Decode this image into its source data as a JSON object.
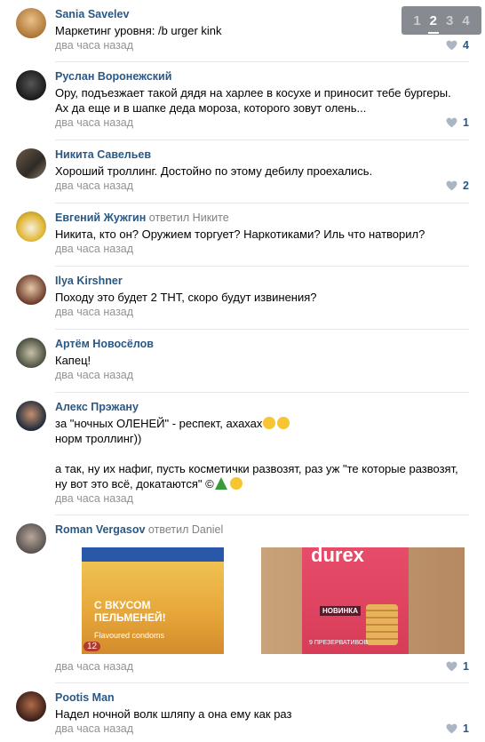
{
  "pager": {
    "pages": [
      "1",
      "2",
      "3",
      "4"
    ],
    "active": "2"
  },
  "comments": [
    {
      "author": "Sania Savelev",
      "replied_to": "",
      "text": "Маркетинг уровня: /b urger kink",
      "time": "два часа назад",
      "likes": "4"
    },
    {
      "author": "Руслан Воронежский",
      "replied_to": "",
      "text": "Ору, подъезжает такой дядя на харлее в косухе и приносит тебе бургеры.\nАх да еще и в шапке деда мороза, которого зовут олень...",
      "time": "два часа назад",
      "likes": "1"
    },
    {
      "author": "Никита Савельев",
      "replied_to": "",
      "text": "Хороший троллинг. Достойно по этому дебилу проехались.",
      "time": "два часа назад",
      "likes": "2"
    },
    {
      "author": "Евгений Жужгин",
      "replied_to": "ответил Никите",
      "text": "Никита, кто он? Оружием торгует? Наркотиками? Иль что натворил?",
      "time": "два часа назад",
      "likes": ""
    },
    {
      "author": "Ilya Kirshner",
      "replied_to": "",
      "text": "Походу это будет 2 ТНТ, скоро будут извинения?",
      "time": "два часа назад",
      "likes": ""
    },
    {
      "author": "Артём Новосёлов",
      "replied_to": "",
      "text": "Капец!",
      "time": "два часа назад",
      "likes": ""
    },
    {
      "author": "Алекс Прэжану",
      "replied_to": "",
      "text_line1": "за \"ночных ОЛЕНЕЙ\" - респект, ахахах",
      "text_line2": "норм троллинг))",
      "text_line3": "а так, ну их нафиг, пусть косметички развозят, раз уж \"те которые развозят,",
      "text_line4": "ну вот это всё, докатаются\" ©",
      "time": "два часа назад",
      "likes": ""
    },
    {
      "author": "Roman Vergasov",
      "replied_to": "ответил Daniel",
      "photo1_text": "С ВКУСОМ ПЕЛЬМЕНЕЙ!",
      "photo1_sub": "Flavoured condoms",
      "photo1_num": "12",
      "photo2_brand": "durex",
      "photo2_badge": "НОВИНКА",
      "photo2_sub": "9 ПРЕЗЕРВАТИВОВ",
      "time": "два часа назад",
      "likes": "1"
    },
    {
      "author": "Pootis Man",
      "replied_to": "",
      "text": "Надел ночной волк шляпу а она ему как раз",
      "time": "два часа назад",
      "likes": "1"
    }
  ]
}
